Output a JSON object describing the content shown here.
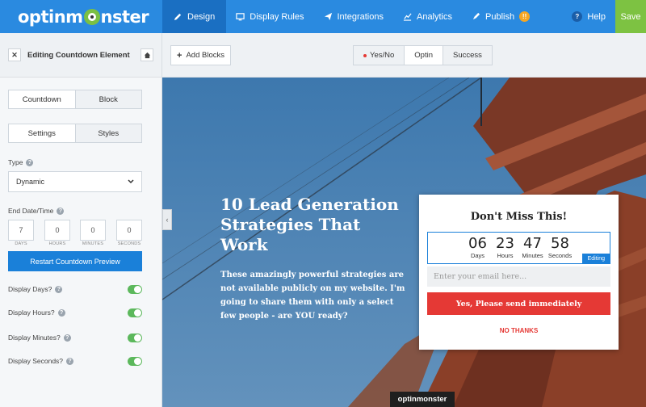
{
  "app": {
    "logo": "optinmonster"
  },
  "nav": {
    "items": [
      {
        "label": "Design",
        "icon": "pencil-icon"
      },
      {
        "label": "Display Rules",
        "icon": "monitor-icon"
      },
      {
        "label": "Integrations",
        "icon": "plane-icon"
      },
      {
        "label": "Analytics",
        "icon": "chart-icon"
      },
      {
        "label": "Publish",
        "icon": "rocket-icon",
        "badge": "!!"
      }
    ],
    "help_label": "Help",
    "save_label": "Save"
  },
  "sidebar": {
    "title": "Editing Countdown Element",
    "tabs1": [
      "Countdown",
      "Block"
    ],
    "tabs2": [
      "Settings",
      "Styles"
    ],
    "type_label": "Type",
    "type_value": "Dynamic",
    "end_label": "End Date/Time",
    "date_values": [
      "7",
      "0",
      "0",
      "0"
    ],
    "date_labels": [
      "DAYS",
      "HOURS",
      "MINUTES",
      "SECONDS"
    ],
    "restart_label": "Restart Countdown Preview",
    "toggles": [
      {
        "label": "Display Days?",
        "on": true
      },
      {
        "label": "Display Hours?",
        "on": true
      },
      {
        "label": "Display Minutes?",
        "on": true
      },
      {
        "label": "Display Seconds?",
        "on": true
      }
    ]
  },
  "toolbar": {
    "add_blocks": "Add Blocks",
    "views": [
      "Yes/No",
      "Optin",
      "Success"
    ]
  },
  "canvas": {
    "headline": "10 Lead Generation Strategies That Work",
    "body": "These amazingly powerful strategies are not available publicly on my website. I'm going to share them with only a select few people - are YOU ready?",
    "brand": "optinmonster"
  },
  "popup": {
    "title": "Don't Miss This!",
    "countdown": [
      {
        "num": "06",
        "label": "Days"
      },
      {
        "num": "23",
        "label": "Hours"
      },
      {
        "num": "47",
        "label": "Minutes"
      },
      {
        "num": "58",
        "label": "Seconds"
      }
    ],
    "editing_label": "Editing",
    "email_placeholder": "Enter your email here...",
    "cta_label": "Yes, Please send immediately",
    "decline_label": "NO THANKS"
  },
  "colors": {
    "nav": "#2a8ae0",
    "save": "#7dc242",
    "accent": "#1a80d9",
    "cta": "#e53935"
  }
}
